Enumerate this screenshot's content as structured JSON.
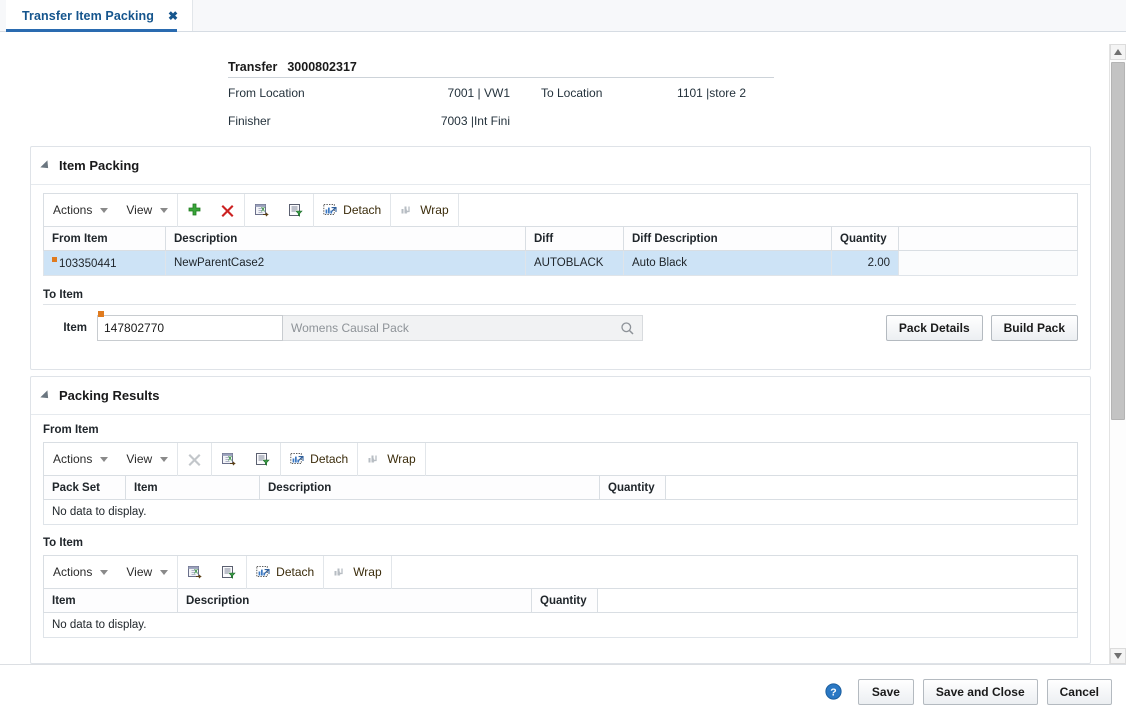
{
  "tab": {
    "label": "Transfer Item Packing",
    "close_label": "✖"
  },
  "record_header": {
    "transfer_label": "Transfer",
    "transfer_number": "3000802317",
    "from_location_label": "From Location",
    "from_location_value": "7001 | VW1",
    "to_location_label": "To Location",
    "to_location_value": "1101 |store 2",
    "finisher_label": "Finisher",
    "finisher_value": "7003 |Int Fini"
  },
  "item_packing": {
    "title": "Item Packing",
    "toolbar": {
      "actions": "Actions",
      "view": "View",
      "add": "add-icon",
      "delete": "delete-icon",
      "export": "export-to-excel-icon",
      "query": "query-by-example-icon",
      "detach": "Detach",
      "wrap": "Wrap"
    },
    "columns": [
      "From Item",
      "Description",
      "Diff",
      "Diff Description",
      "Quantity"
    ],
    "rows": [
      {
        "from_item": "103350441",
        "description": "NewParentCase2",
        "diff": "AUTOBLACK",
        "diff_description": "Auto Black",
        "quantity": "2.00"
      }
    ],
    "to_item": {
      "section_label": "To Item",
      "field_label": "Item",
      "value": "147802770",
      "description": "Womens Causal Pack",
      "pack_details_button": "Pack Details",
      "build_pack_button": "Build Pack"
    }
  },
  "packing_results": {
    "title": "Packing Results",
    "from_item": {
      "label": "From Item",
      "toolbar": {
        "actions": "Actions",
        "view": "View",
        "delete": "delete-icon-disabled",
        "export": "export-to-excel-icon",
        "query": "query-by-example-icon",
        "detach": "Detach",
        "wrap": "Wrap"
      },
      "columns": [
        "Pack Set",
        "Item",
        "Description",
        "Quantity"
      ],
      "empty_text": "No data to display."
    },
    "to_item": {
      "label": "To Item",
      "toolbar": {
        "actions": "Actions",
        "view": "View",
        "export": "export-to-excel-icon",
        "query": "query-by-example-icon",
        "detach": "Detach",
        "wrap": "Wrap"
      },
      "columns": [
        "Item",
        "Description",
        "Quantity"
      ],
      "empty_text": "No data to display."
    }
  },
  "footer": {
    "help": "help-icon",
    "save": "Save",
    "save_and_close": "Save and Close",
    "cancel": "Cancel"
  },
  "colors": {
    "tab_accent": "#2a6bb0",
    "selected_row": "#cde3f6",
    "required_marker": "#e07b1f",
    "link_text": "#15558d"
  }
}
